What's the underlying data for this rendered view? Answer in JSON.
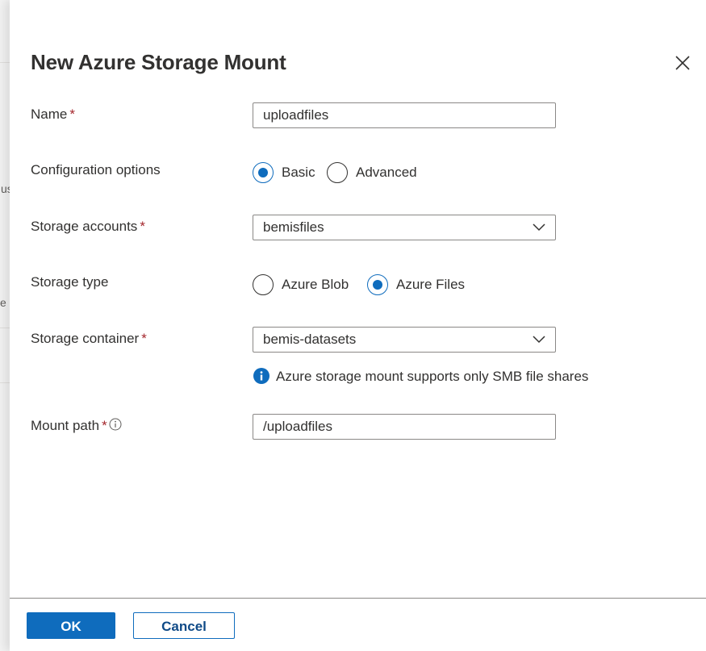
{
  "background": {
    "fragment_text_1": "us",
    "fragment_text_2": "e"
  },
  "dialog": {
    "title": "New Azure Storage Mount",
    "close_icon": "close-icon"
  },
  "form": {
    "name": {
      "label": "Name",
      "required_mark": "*",
      "value": "uploadfiles"
    },
    "configuration_options": {
      "label": "Configuration options",
      "options": [
        {
          "label": "Basic",
          "selected": true
        },
        {
          "label": "Advanced",
          "selected": false
        }
      ]
    },
    "storage_accounts": {
      "label": "Storage accounts",
      "required_mark": "*",
      "value": "bemisfiles",
      "icon": "chevron-down-icon"
    },
    "storage_type": {
      "label": "Storage type",
      "options": [
        {
          "label": "Azure Blob",
          "selected": false
        },
        {
          "label": "Azure Files",
          "selected": true
        }
      ]
    },
    "storage_container": {
      "label": "Storage container",
      "required_mark": "*",
      "value": "bemis-datasets",
      "icon": "chevron-down-icon",
      "info_message": "Azure storage mount supports only SMB file shares",
      "info_icon": "info-icon"
    },
    "mount_path": {
      "label": "Mount path",
      "required_mark": "*",
      "info_icon": "info-circle-icon",
      "value": "/uploadfiles"
    }
  },
  "footer": {
    "ok_label": "OK",
    "cancel_label": "Cancel"
  },
  "colors": {
    "accent": "#0f6cbd",
    "required": "#a4262c",
    "text": "#323130",
    "border": "#8a8886"
  }
}
